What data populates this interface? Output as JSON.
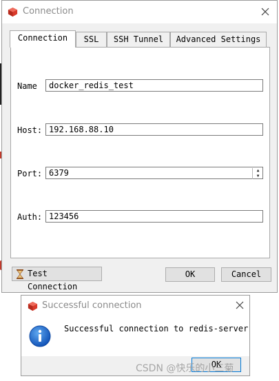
{
  "window": {
    "title": "Connection",
    "tabs": [
      {
        "label": "Connection",
        "active": true
      },
      {
        "label": "SSL",
        "active": false
      },
      {
        "label": "SSH Tunnel",
        "active": false
      },
      {
        "label": "Advanced Settings",
        "active": false
      }
    ],
    "fields": {
      "name": {
        "label": "Name",
        "value": "docker_redis_test"
      },
      "host": {
        "label": "Host:",
        "value": "192.168.88.10"
      },
      "port": {
        "label": "Port:",
        "value": "6379"
      },
      "auth": {
        "label": "Auth:",
        "value": "123456"
      }
    },
    "buttons": {
      "test_connection": "Test Connection",
      "ok": "OK",
      "cancel": "Cancel"
    }
  },
  "dialog": {
    "title": "Successful connection",
    "message": "Successful connection to redis-server",
    "ok": "OK"
  },
  "watermark": "CSDN @快乐的小三菊",
  "colors": {
    "logo_red": "#d93a2b",
    "info_blue": "#1565c0",
    "focus_border": "#0078d7"
  }
}
